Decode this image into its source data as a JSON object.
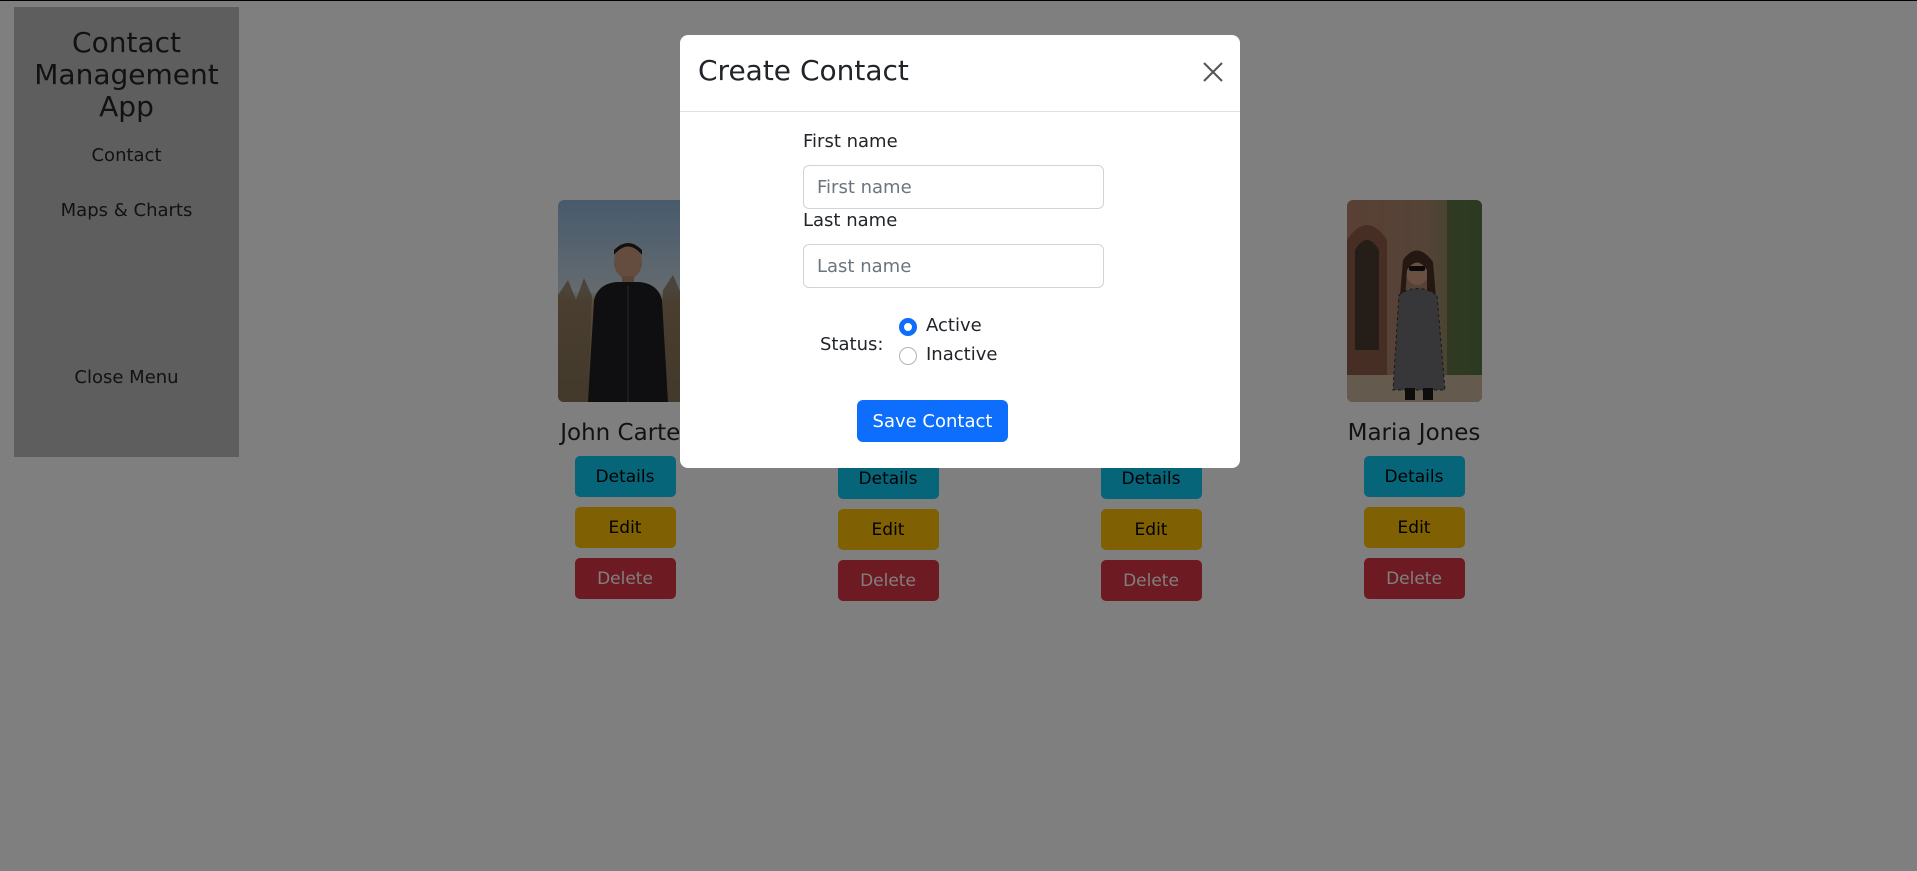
{
  "sidebar": {
    "title": "Contact Management App",
    "nav": [
      "Contact",
      "Maps & Charts"
    ],
    "close_menu": "Close Menu"
  },
  "contacts": [
    {
      "name": "John Carter",
      "details": "Details",
      "edit": "Edit",
      "delete": "Delete"
    },
    {
      "name": "",
      "details": "Details",
      "edit": "Edit",
      "delete": "Delete"
    },
    {
      "name": "",
      "details": "Details",
      "edit": "Edit",
      "delete": "Delete"
    },
    {
      "name": "Maria Jones",
      "details": "Details",
      "edit": "Edit",
      "delete": "Delete"
    }
  ],
  "modal": {
    "title": "Create Contact",
    "close_icon": "close-icon",
    "first_name_label": "First name",
    "first_name_placeholder": "First name",
    "first_name_value": "",
    "last_name_label": "Last name",
    "last_name_placeholder": "Last name",
    "last_name_value": "",
    "status_label": "Status:",
    "status_options": [
      "Active",
      "Inactive"
    ],
    "status_selected": "Active",
    "save_label": "Save Contact"
  },
  "colors": {
    "primary": "#0d6efd",
    "info": "#0dcaf0",
    "warning": "#ffc107",
    "danger": "#dc3545",
    "sidebar_bg": "#bdbdbd",
    "backdrop": "rgba(0,0,0,0.5)"
  }
}
